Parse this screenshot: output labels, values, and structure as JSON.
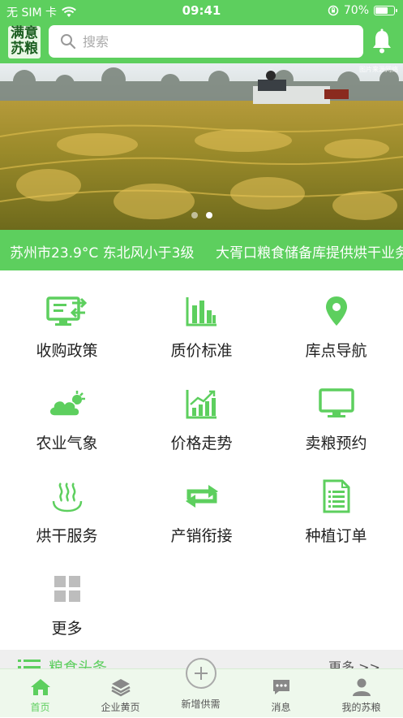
{
  "status": {
    "carrier": "无 SIM 卡",
    "time": "09:41",
    "battery": "70%",
    "battery_level": 0.7
  },
  "header": {
    "logo_line1": "满意",
    "logo_line2": "苏粮",
    "search_placeholder": "搜索"
  },
  "banner": {
    "watermark": "图片来源网络",
    "active_slide": 1,
    "slide_count": 2
  },
  "ticker": {
    "text1": "苏州市23.9°C 东北风小于3级",
    "text2": "大胥口粮食储备库提供烘干业务"
  },
  "menu": [
    {
      "label": "收购政策",
      "icon": "monitor-policy-icon"
    },
    {
      "label": "质价标准",
      "icon": "bar-chart-icon"
    },
    {
      "label": "库点导航",
      "icon": "location-pin-icon"
    },
    {
      "label": "农业气象",
      "icon": "weather-cloud-icon"
    },
    {
      "label": "价格走势",
      "icon": "trend-chart-icon"
    },
    {
      "label": "卖粮预约",
      "icon": "screen-appointment-icon"
    },
    {
      "label": "烘干服务",
      "icon": "steam-drying-icon"
    },
    {
      "label": "产销衔接",
      "icon": "exchange-arrows-icon"
    },
    {
      "label": "种植订单",
      "icon": "document-order-icon"
    },
    {
      "label": "更多",
      "icon": "grid-more-icon"
    }
  ],
  "news": {
    "title": "粮食头条",
    "more": "更多 >>"
  },
  "tabs": [
    {
      "label": "首页",
      "icon": "home-icon"
    },
    {
      "label": "企业黄页",
      "icon": "layers-icon"
    },
    {
      "label": "新增供需",
      "icon": "plus-circle-icon"
    },
    {
      "label": "消息",
      "icon": "message-icon"
    },
    {
      "label": "我的苏粮",
      "icon": "user-icon"
    }
  ],
  "colors": {
    "brand": "#5dcf5e",
    "text": "#222222",
    "muted": "#555555",
    "disabled": "#bdbdbd"
  }
}
